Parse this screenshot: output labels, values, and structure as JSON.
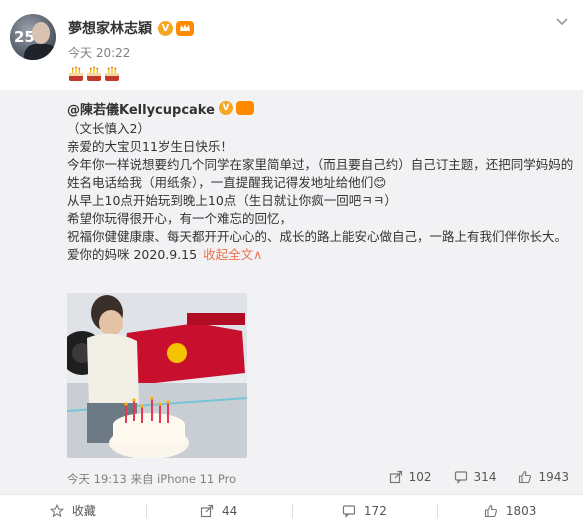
{
  "post": {
    "author": "夢想家林志穎",
    "verified_mark": "V",
    "time": "今天 20:22",
    "emojis": [
      "cake",
      "cake",
      "cake"
    ],
    "avatar_text": "25"
  },
  "repost": {
    "author": "@陳若儀Kellycupcake",
    "verified_mark": "V",
    "lines": [
      "（文长慎入2）",
      "亲爱的大宝贝11岁生日快乐！",
      "今年你一样说想要约几个同学在家里简单过，（而且要自己约）自己订主题，还把同学妈妈的",
      "姓名电话给我（用纸条），一直提醒我记得发地址给他们😊",
      "从早上10点开始玩到晚上10点（生日就让你疯一回吧ㅋㅋ）",
      "希望你玩得很开心，有一个难忘的回忆，",
      "祝福你健健康康、每天都开开心心的、成长的路上能安心做自己，一路上有我们伴你长大。"
    ],
    "signature": "爱你的妈咪 2020.9.15",
    "collapse_label": "收起全文",
    "collapse_arrow": "∧"
  },
  "meta": {
    "source": "今天 19:13 来自 iPhone 11 Pro",
    "shares": "102",
    "comments": "314",
    "likes": "1943"
  },
  "actions": {
    "favorite_label": "收藏",
    "share_count": "44",
    "comment_count": "172",
    "like_count": "1803"
  },
  "colors": {
    "accent": "#eb7350",
    "verified": "#f5a623",
    "repost_bg": "#f2f2f5"
  }
}
